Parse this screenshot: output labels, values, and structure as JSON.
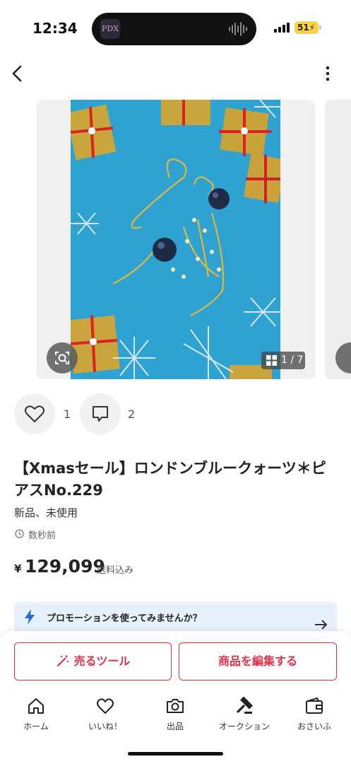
{
  "status_bar": {
    "time": "12:34",
    "battery": "51",
    "island_app": "PDX"
  },
  "product": {
    "image_counter": "1 / 7",
    "like_count": "1",
    "comment_count": "2",
    "title": "【Xmasセール】ロンドンブルークォーツ＊ピアスNo.229",
    "condition": "新品、未使用",
    "listed_time": "数秒前",
    "currency": "¥",
    "price": "129,099",
    "shipping": "送料込み"
  },
  "promotion": {
    "text": "プロモーションを使ってみませんか？"
  },
  "actions": {
    "sell_tool_label": "売るツール",
    "edit_label": "商品を編集する"
  },
  "tabbar": {
    "items": [
      {
        "label": "ホーム",
        "icon": "home-icon"
      },
      {
        "label": "いいね！",
        "icon": "heart-icon"
      },
      {
        "label": "出品",
        "icon": "camera-icon"
      },
      {
        "label": "オークション",
        "icon": "gavel-icon"
      },
      {
        "label": "おさいふ",
        "icon": "wallet-icon"
      }
    ]
  },
  "colors": {
    "accent_red": "#e0304a",
    "promo_blue": "#1f6fd6",
    "promo_bg": "#e8f1fb"
  }
}
